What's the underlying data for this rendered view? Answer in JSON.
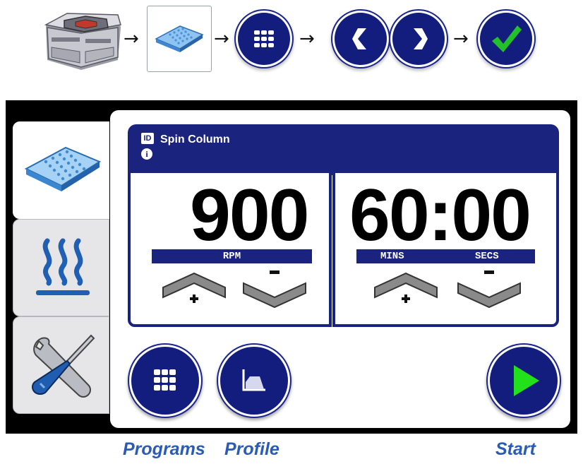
{
  "workflow": {
    "steps": [
      {
        "name": "instrument-icon"
      },
      {
        "name": "plate-icon"
      },
      {
        "name": "programs-grid-icon"
      },
      {
        "name": "chevron-left-icon"
      },
      {
        "name": "chevron-right-icon"
      },
      {
        "name": "checkmark-icon"
      }
    ],
    "arrow_glyph": "→"
  },
  "sidebar": {
    "tabs": [
      {
        "name": "tab-plate",
        "icon": "plate-icon",
        "active": true
      },
      {
        "name": "tab-heat",
        "icon": "heat-waves-icon",
        "active": false
      },
      {
        "name": "tab-tools",
        "icon": "wrench-screwdriver-icon",
        "active": false
      }
    ]
  },
  "header": {
    "id_badge": "ID",
    "program_name": "Spin Column",
    "info_badge": "i"
  },
  "speed": {
    "value": "900",
    "unit": "RPM"
  },
  "timer": {
    "value": "60:00",
    "unit_minutes": "MINS",
    "unit_seconds": "SECS"
  },
  "captions": {
    "programs": "Programs",
    "profile": "Profile",
    "start": "Start"
  },
  "colors": {
    "panel_blue": "#1a237e",
    "button_blue": "#131d7d",
    "caption_blue": "#2a5bb5",
    "check_green": "#22c12c",
    "start_green": "#22e01a"
  }
}
